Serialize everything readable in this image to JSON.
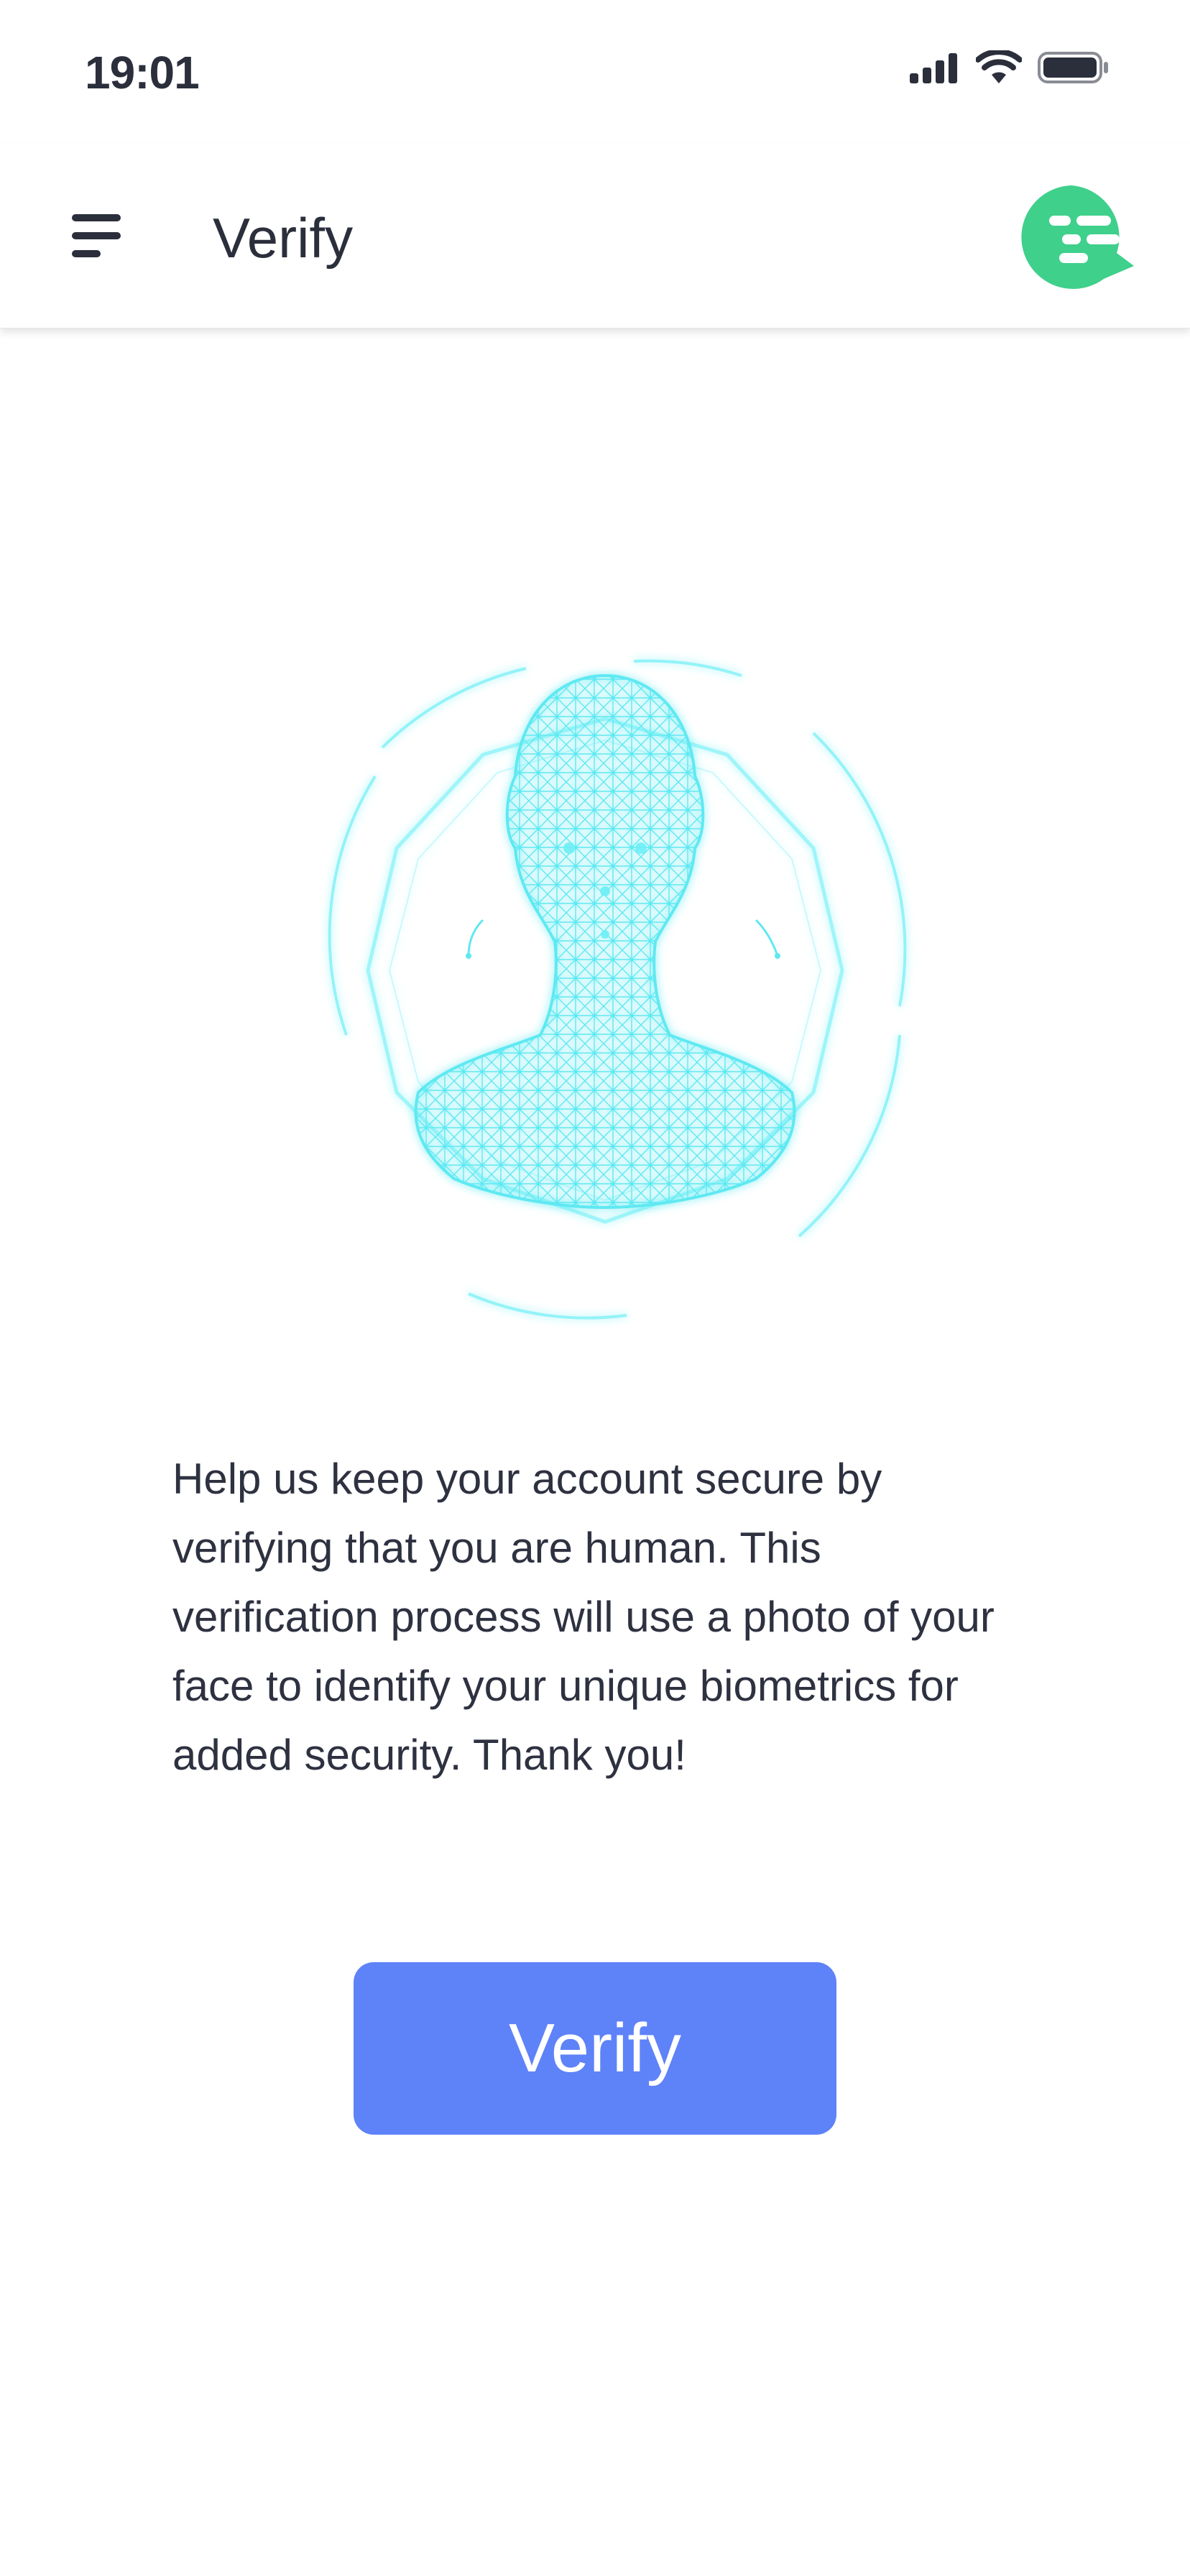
{
  "status_bar": {
    "time": "19:01",
    "icons": [
      "signal-icon",
      "wifi-icon",
      "battery-icon"
    ]
  },
  "header": {
    "title": "Verify",
    "menu_icon": "hamburger-menu-icon",
    "chat_icon": "chat-bubble-icon"
  },
  "hero": {
    "image": "face-scan-mesh-illustration"
  },
  "description": "Help us keep your account secure by verifying that you are human. This verification process will use a photo of your face to identify your unique biometrics for added security. Thank you!",
  "verify_button": {
    "label": "Verify"
  },
  "colors": {
    "accent": "#5e82f8",
    "chat_icon": "#3fd08c",
    "mesh": "#5ee9f2",
    "text": "#2b2e3b"
  }
}
